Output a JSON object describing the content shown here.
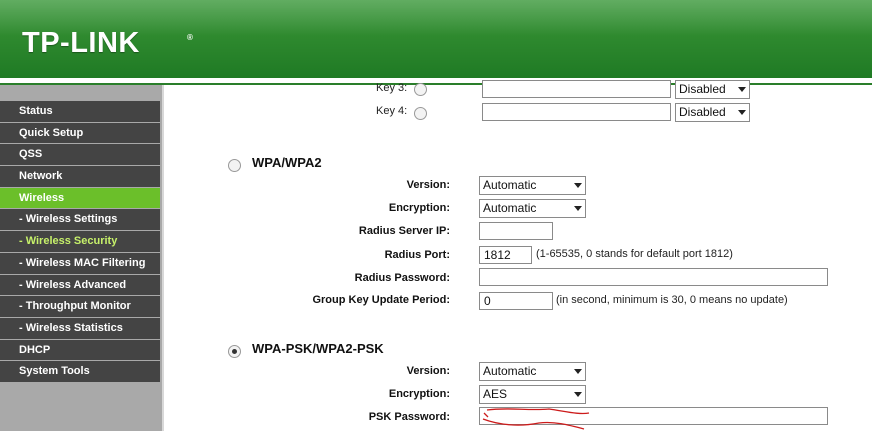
{
  "header": {
    "logo_text": "TP-LINK",
    "logo_mark": "®",
    "brand_color": "#2f8a2f"
  },
  "sidebar": {
    "items": [
      {
        "label": "Status"
      },
      {
        "label": "Quick Setup"
      },
      {
        "label": "QSS"
      },
      {
        "label": "Network"
      },
      {
        "label": "Wireless"
      },
      {
        "label": "- Wireless Settings"
      },
      {
        "label": "- Wireless Security"
      },
      {
        "label": "- Wireless MAC Filtering"
      },
      {
        "label": "- Wireless Advanced"
      },
      {
        "label": "- Throughput Monitor"
      },
      {
        "label": "- Wireless Statistics"
      },
      {
        "label": "DHCP"
      },
      {
        "label": "System Tools"
      }
    ],
    "active_color": "#6bbf2a"
  },
  "wep_keys": {
    "key3_label": "Key 3:",
    "key3_type": "Disabled",
    "key4_label": "Key 4:",
    "key4_type": "Disabled"
  },
  "wpa": {
    "title": "WPA/WPA2",
    "version_label": "Version:",
    "version_value": "Automatic",
    "encryption_label": "Encryption:",
    "encryption_value": "Automatic",
    "radius_ip_label": "Radius Server IP:",
    "radius_ip_value": "",
    "radius_port_label": "Radius Port:",
    "radius_port_value": "1812",
    "radius_port_hint": "(1-65535, 0 stands for default port 1812)",
    "radius_password_label": "Radius Password:",
    "radius_password_value": "",
    "group_key_label": "Group Key Update Period:",
    "group_key_value": "0",
    "group_key_hint": "(in second, minimum is 30, 0 means no update)"
  },
  "wpa_psk": {
    "title": "WPA-PSK/WPA2-PSK",
    "version_label": "Version:",
    "version_value": "Automatic",
    "encryption_label": "Encryption:",
    "encryption_value": "AES",
    "psk_label": "PSK Password:"
  }
}
